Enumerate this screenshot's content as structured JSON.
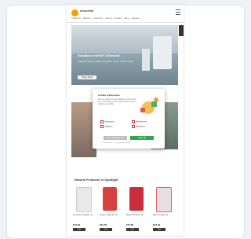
{
  "header": {
    "logo_text": "eboxelite",
    "nav": [
      "Products",
      "Brands",
      "Industries",
      "About",
      "Contact",
      "Blog",
      "Support"
    ]
  },
  "hero": {
    "title": "Sundance eSeal® 4 Element",
    "subtitle": "Superior seal to protect concrete, wood, brick & stone.",
    "button": "Shop Now"
  },
  "tile_b_caption": "Coatings",
  "cookie_modal": {
    "title": "Cookie preferences",
    "body": "We use cookies to personalize content and ads, to provide social media features and to analyse our traffic.",
    "options": [
      "Necessary",
      "Preferences",
      "Statistics",
      "Marketing"
    ],
    "decline_label": "Use necessary only",
    "accept_label": "Allow all",
    "footer_text": "Show details · Privacy policy · Imprint"
  },
  "section_title": "Newest Products in Spotlight",
  "products": [
    {
      "name": "Concrete Sealer 1L",
      "price": "€19.90",
      "buy": "Add",
      "color": "#e9e9e9"
    },
    {
      "name": "Stone Cleaner 5L",
      "price": "€34.50",
      "buy": "Add",
      "color": "#d94141"
    },
    {
      "name": "Wood Protect 2L",
      "price": "€27.80",
      "buy": "Add",
      "color": "#c92f3a"
    },
    {
      "name": "Brick Guard 1L",
      "price": "€22.40",
      "buy": "Add",
      "color": "#e8dfe2"
    }
  ],
  "colors": {
    "accent": "#2fa84f",
    "logo": "#f0a20a",
    "decline": "#bdbdbd"
  }
}
